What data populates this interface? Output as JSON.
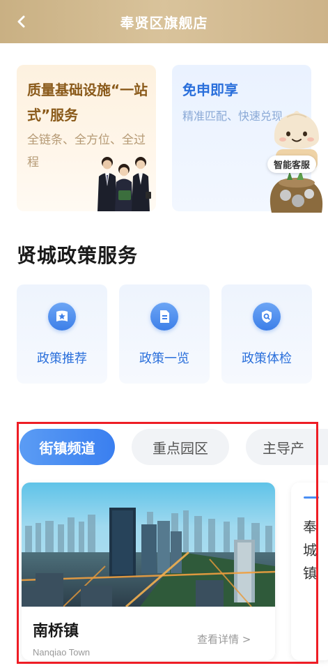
{
  "header": {
    "title": "奉贤区旗舰店"
  },
  "cards": {
    "quality": {
      "title": "质量基础设施“一站式”服务",
      "subtitle": "全链条、全方位、全过程"
    },
    "free": {
      "title": "免申即享",
      "subtitle": "精准匹配、快速兑现"
    }
  },
  "assistant": {
    "label": "智能客服"
  },
  "policy_section": {
    "title": "贤城政策服务",
    "items": [
      {
        "label": "政策推荐",
        "icon": "book-star-icon"
      },
      {
        "label": "政策一览",
        "icon": "document-list-icon"
      },
      {
        "label": "政策体检",
        "icon": "shield-search-icon"
      }
    ]
  },
  "tabs": [
    {
      "label": "街镇频道",
      "active": true
    },
    {
      "label": "重点园区",
      "active": false
    },
    {
      "label": "主导产",
      "active": false
    }
  ],
  "town_cards": [
    {
      "name": "南桥镇",
      "name_en": "Nanqiao Town",
      "detail_link": "查看详情 >"
    },
    {
      "name_partial": "奉城镇"
    }
  ],
  "colors": {
    "header_gold": "#cdb389",
    "accent_blue": "#3a7ff0",
    "highlight_red": "#ee1d25"
  }
}
